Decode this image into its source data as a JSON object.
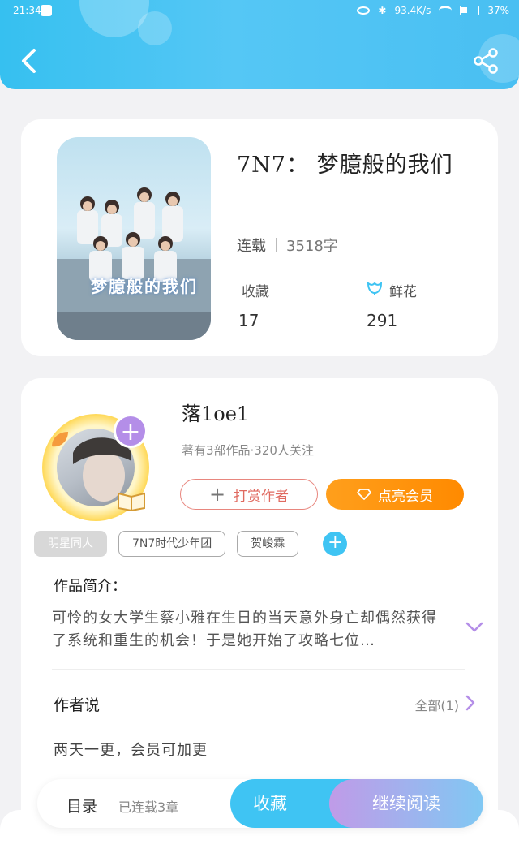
{
  "status_bar": {
    "time": "21:34",
    "network_speed": "93.4K/s",
    "battery": "37%"
  },
  "book": {
    "title": "7N7： 梦臆般的我们",
    "cover_title": "梦臆般的我们",
    "status": "连载",
    "word_count": "3518字",
    "collect_label": "收藏",
    "collect_count": "17",
    "flower_label": "鲜花",
    "flower_count": "291"
  },
  "author": {
    "name": "落1oe1",
    "meta": "著有3部作品·320人关注",
    "tip_label": "打赏作者",
    "vip_label": "点亮会员"
  },
  "tags": [
    "明星同人",
    "7N7时代少年团",
    "贺峻霖"
  ],
  "intro": {
    "label": "作品简介：",
    "text": "可怜的女大学生蔡小雅在生日的当天意外身亡却偶然获得了系统和重生的机会！于是她开始了攻略七位…"
  },
  "author_says": {
    "label": "作者说",
    "all_label": "全部(1)",
    "text": "两天一更，会员可加更"
  },
  "bottom": {
    "toc_label": "目录",
    "toc_count": "已连载3章",
    "collect_label": "收藏",
    "read_label": "继续阅读"
  },
  "colors": {
    "header": "#36c0f0",
    "accent_blue": "#3fc4f3",
    "vip_orange": "#ff9f1c",
    "tip_red": "#e06a60",
    "avatar_plus": "#b48ee8"
  }
}
